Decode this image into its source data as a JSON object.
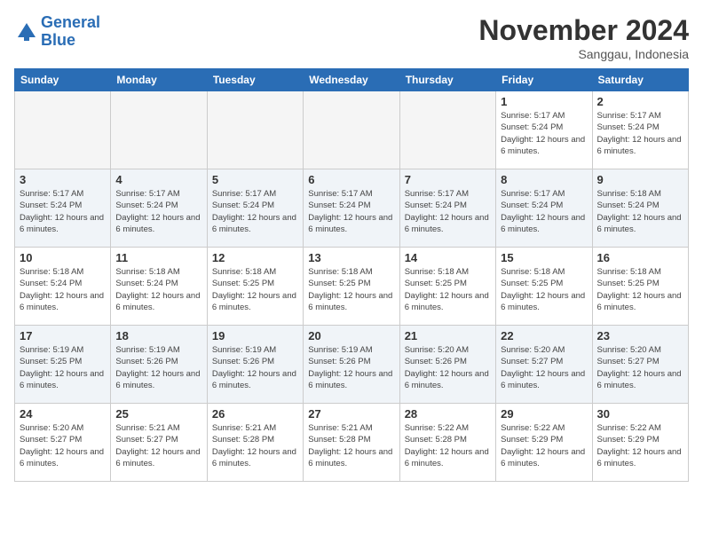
{
  "logo": {
    "line1": "General",
    "line2": "Blue"
  },
  "title": "November 2024",
  "location": "Sanggau, Indonesia",
  "days_header": [
    "Sunday",
    "Monday",
    "Tuesday",
    "Wednesday",
    "Thursday",
    "Friday",
    "Saturday"
  ],
  "weeks": [
    {
      "shaded": false,
      "days": [
        {
          "num": "",
          "info": "",
          "empty": true
        },
        {
          "num": "",
          "info": "",
          "empty": true
        },
        {
          "num": "",
          "info": "",
          "empty": true
        },
        {
          "num": "",
          "info": "",
          "empty": true
        },
        {
          "num": "",
          "info": "",
          "empty": true
        },
        {
          "num": "1",
          "info": "Sunrise: 5:17 AM\nSunset: 5:24 PM\nDaylight: 12 hours and 6 minutes.",
          "empty": false
        },
        {
          "num": "2",
          "info": "Sunrise: 5:17 AM\nSunset: 5:24 PM\nDaylight: 12 hours and 6 minutes.",
          "empty": false
        }
      ]
    },
    {
      "shaded": true,
      "days": [
        {
          "num": "3",
          "info": "Sunrise: 5:17 AM\nSunset: 5:24 PM\nDaylight: 12 hours and 6 minutes.",
          "empty": false
        },
        {
          "num": "4",
          "info": "Sunrise: 5:17 AM\nSunset: 5:24 PM\nDaylight: 12 hours and 6 minutes.",
          "empty": false
        },
        {
          "num": "5",
          "info": "Sunrise: 5:17 AM\nSunset: 5:24 PM\nDaylight: 12 hours and 6 minutes.",
          "empty": false
        },
        {
          "num": "6",
          "info": "Sunrise: 5:17 AM\nSunset: 5:24 PM\nDaylight: 12 hours and 6 minutes.",
          "empty": false
        },
        {
          "num": "7",
          "info": "Sunrise: 5:17 AM\nSunset: 5:24 PM\nDaylight: 12 hours and 6 minutes.",
          "empty": false
        },
        {
          "num": "8",
          "info": "Sunrise: 5:17 AM\nSunset: 5:24 PM\nDaylight: 12 hours and 6 minutes.",
          "empty": false
        },
        {
          "num": "9",
          "info": "Sunrise: 5:18 AM\nSunset: 5:24 PM\nDaylight: 12 hours and 6 minutes.",
          "empty": false
        }
      ]
    },
    {
      "shaded": false,
      "days": [
        {
          "num": "10",
          "info": "Sunrise: 5:18 AM\nSunset: 5:24 PM\nDaylight: 12 hours and 6 minutes.",
          "empty": false
        },
        {
          "num": "11",
          "info": "Sunrise: 5:18 AM\nSunset: 5:24 PM\nDaylight: 12 hours and 6 minutes.",
          "empty": false
        },
        {
          "num": "12",
          "info": "Sunrise: 5:18 AM\nSunset: 5:25 PM\nDaylight: 12 hours and 6 minutes.",
          "empty": false
        },
        {
          "num": "13",
          "info": "Sunrise: 5:18 AM\nSunset: 5:25 PM\nDaylight: 12 hours and 6 minutes.",
          "empty": false
        },
        {
          "num": "14",
          "info": "Sunrise: 5:18 AM\nSunset: 5:25 PM\nDaylight: 12 hours and 6 minutes.",
          "empty": false
        },
        {
          "num": "15",
          "info": "Sunrise: 5:18 AM\nSunset: 5:25 PM\nDaylight: 12 hours and 6 minutes.",
          "empty": false
        },
        {
          "num": "16",
          "info": "Sunrise: 5:18 AM\nSunset: 5:25 PM\nDaylight: 12 hours and 6 minutes.",
          "empty": false
        }
      ]
    },
    {
      "shaded": true,
      "days": [
        {
          "num": "17",
          "info": "Sunrise: 5:19 AM\nSunset: 5:25 PM\nDaylight: 12 hours and 6 minutes.",
          "empty": false
        },
        {
          "num": "18",
          "info": "Sunrise: 5:19 AM\nSunset: 5:26 PM\nDaylight: 12 hours and 6 minutes.",
          "empty": false
        },
        {
          "num": "19",
          "info": "Sunrise: 5:19 AM\nSunset: 5:26 PM\nDaylight: 12 hours and 6 minutes.",
          "empty": false
        },
        {
          "num": "20",
          "info": "Sunrise: 5:19 AM\nSunset: 5:26 PM\nDaylight: 12 hours and 6 minutes.",
          "empty": false
        },
        {
          "num": "21",
          "info": "Sunrise: 5:20 AM\nSunset: 5:26 PM\nDaylight: 12 hours and 6 minutes.",
          "empty": false
        },
        {
          "num": "22",
          "info": "Sunrise: 5:20 AM\nSunset: 5:27 PM\nDaylight: 12 hours and 6 minutes.",
          "empty": false
        },
        {
          "num": "23",
          "info": "Sunrise: 5:20 AM\nSunset: 5:27 PM\nDaylight: 12 hours and 6 minutes.",
          "empty": false
        }
      ]
    },
    {
      "shaded": false,
      "days": [
        {
          "num": "24",
          "info": "Sunrise: 5:20 AM\nSunset: 5:27 PM\nDaylight: 12 hours and 6 minutes.",
          "empty": false
        },
        {
          "num": "25",
          "info": "Sunrise: 5:21 AM\nSunset: 5:27 PM\nDaylight: 12 hours and 6 minutes.",
          "empty": false
        },
        {
          "num": "26",
          "info": "Sunrise: 5:21 AM\nSunset: 5:28 PM\nDaylight: 12 hours and 6 minutes.",
          "empty": false
        },
        {
          "num": "27",
          "info": "Sunrise: 5:21 AM\nSunset: 5:28 PM\nDaylight: 12 hours and 6 minutes.",
          "empty": false
        },
        {
          "num": "28",
          "info": "Sunrise: 5:22 AM\nSunset: 5:28 PM\nDaylight: 12 hours and 6 minutes.",
          "empty": false
        },
        {
          "num": "29",
          "info": "Sunrise: 5:22 AM\nSunset: 5:29 PM\nDaylight: 12 hours and 6 minutes.",
          "empty": false
        },
        {
          "num": "30",
          "info": "Sunrise: 5:22 AM\nSunset: 5:29 PM\nDaylight: 12 hours and 6 minutes.",
          "empty": false
        }
      ]
    }
  ]
}
